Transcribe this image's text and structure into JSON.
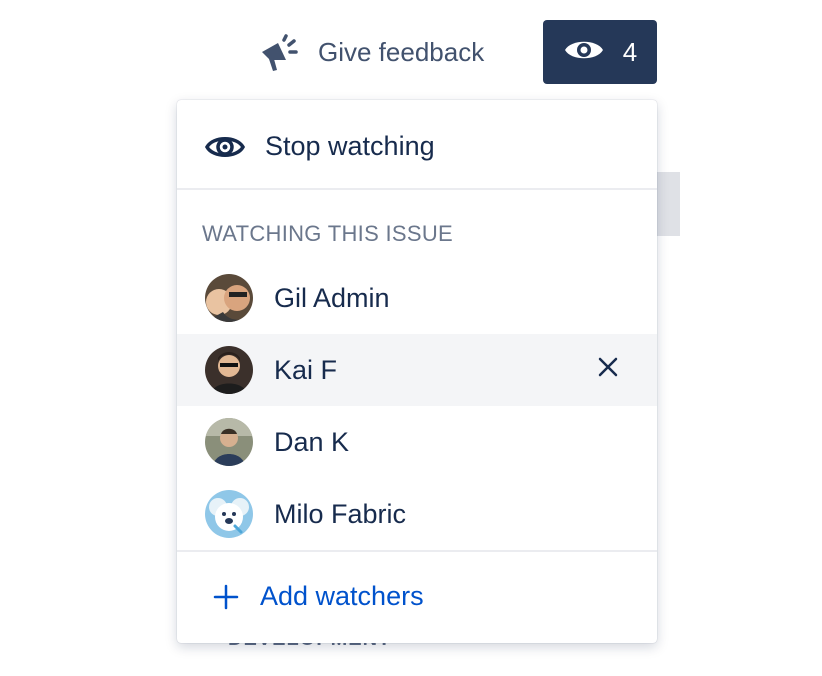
{
  "header": {
    "feedback_label": "Give feedback",
    "feedback_icon": "megaphone-icon",
    "watch_icon": "eye-icon",
    "watch_count": "4"
  },
  "background": {
    "section_label": "DEVELOPMENT"
  },
  "popup": {
    "stop_watching_label": "Stop watching",
    "section_heading": "WATCHING THIS ISSUE",
    "watchers": [
      {
        "name": "Gil Admin"
      },
      {
        "name": "Kai F"
      },
      {
        "name": "Dan K"
      },
      {
        "name": "Milo Fabric"
      }
    ],
    "add_watchers_label": "Add watchers"
  },
  "colors": {
    "primary_dark": "#253858",
    "link_blue": "#0052cc",
    "text": "#172b4d",
    "subtle_text": "#6b778c",
    "hover_bg": "#f4f5f7"
  }
}
